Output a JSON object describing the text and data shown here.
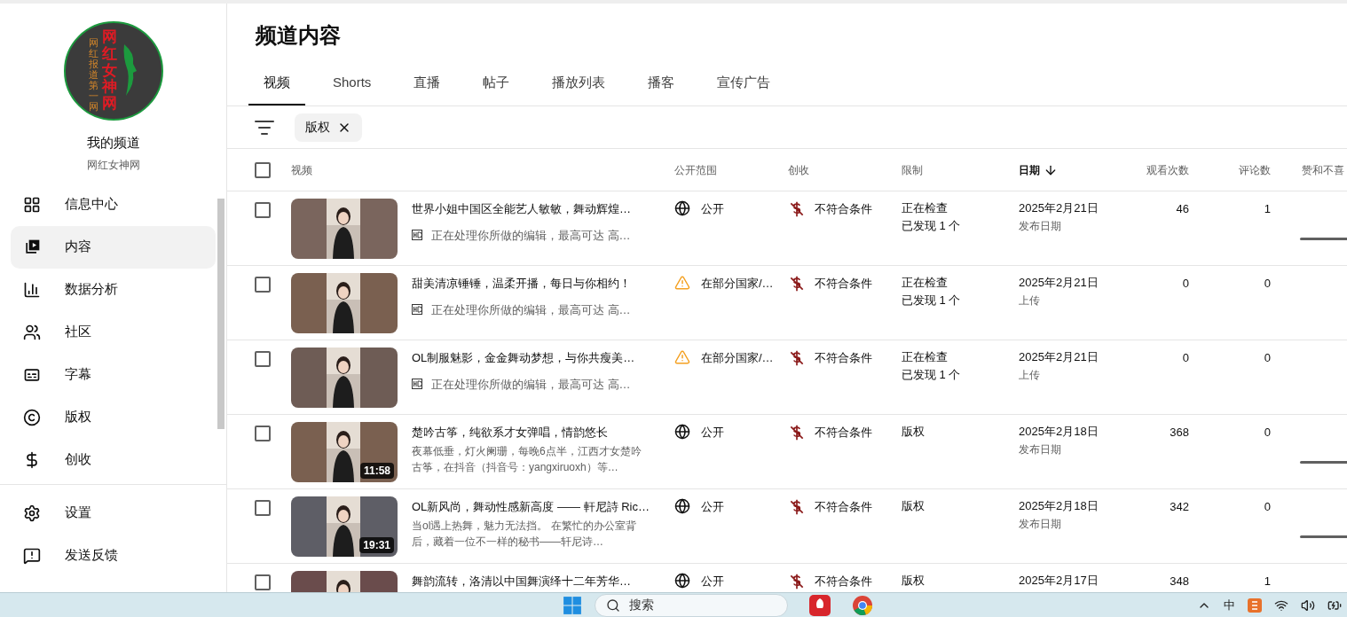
{
  "channel": {
    "logo_title": "网红女神网",
    "logo_slogan": "网红报道第一网",
    "name": "我的频道",
    "handle": "网红女神网"
  },
  "sidebar": {
    "items": [
      {
        "kind": "dashboard",
        "label": "信息中心",
        "selected": false
      },
      {
        "kind": "content",
        "label": "内容",
        "selected": true
      },
      {
        "kind": "analytics",
        "label": "数据分析",
        "selected": false
      },
      {
        "kind": "community",
        "label": "社区",
        "selected": false
      },
      {
        "kind": "subtitles",
        "label": "字幕",
        "selected": false
      },
      {
        "kind": "copyright",
        "label": "版权",
        "selected": false
      },
      {
        "kind": "earn",
        "label": "创收",
        "selected": false
      }
    ],
    "footer_items": [
      {
        "kind": "settings",
        "label": "设置"
      },
      {
        "kind": "feedback",
        "label": "发送反馈"
      }
    ]
  },
  "page": {
    "title": "频道内容"
  },
  "tabs": [
    {
      "label": "视频",
      "selected": true
    },
    {
      "label": "Shorts",
      "selected": false
    },
    {
      "label": "直播",
      "selected": false
    },
    {
      "label": "帖子",
      "selected": false
    },
    {
      "label": "播放列表",
      "selected": false
    },
    {
      "label": "播客",
      "selected": false
    },
    {
      "label": "宣传广告",
      "selected": false
    }
  ],
  "filter_chips": [
    {
      "label": "版权"
    }
  ],
  "table": {
    "select_all_checked": false,
    "columns": [
      {
        "label": "视频",
        "sorted": false
      },
      {
        "label": "公开范围",
        "sorted": false
      },
      {
        "label": "创收",
        "sorted": false
      },
      {
        "label": "限制",
        "sorted": false
      },
      {
        "label": "日期",
        "sorted": true
      },
      {
        "label": "观看次数",
        "sorted": false
      },
      {
        "label": "评论数",
        "sorted": false
      },
      {
        "label": "赞和不喜",
        "sorted": false
      }
    ],
    "rows": [
      {
        "checked": false,
        "title": "世界小姐中国区全能艺人敏敏，舞动辉煌…",
        "kind": "processing",
        "note": "正在处理你所做的编辑，最高可达 高…",
        "visibility": {
          "kind": "public",
          "label": "公开"
        },
        "monetization": "不符合条件",
        "restriction": [
          "正在检查",
          "已发现 1 个"
        ],
        "date": "2025年2月21日",
        "date_kind": "发布日期",
        "views": "46",
        "comments": "1",
        "like_bar": true
      },
      {
        "checked": false,
        "title": "甜美清凉锤锤，温柔开播，每日与你相约！",
        "kind": "processing",
        "note": "正在处理你所做的编辑，最高可达 高…",
        "visibility": {
          "kind": "restricted",
          "label": "在部分国家/…"
        },
        "monetization": "不符合条件",
        "restriction": [
          "正在检查",
          "已发现 1 个"
        ],
        "date": "2025年2月21日",
        "date_kind": "上传",
        "views": "0",
        "comments": "0",
        "like_bar": false
      },
      {
        "checked": false,
        "title": "OL制服魅影，金金舞动梦想，与你共瘦美…",
        "kind": "processing",
        "note": "正在处理你所做的编辑，最高可达 高…",
        "visibility": {
          "kind": "restricted",
          "label": "在部分国家/…"
        },
        "monetization": "不符合条件",
        "restriction": [
          "正在检查",
          "已发现 1 个"
        ],
        "date": "2025年2月21日",
        "date_kind": "上传",
        "views": "0",
        "comments": "0",
        "like_bar": false
      },
      {
        "checked": false,
        "title": "楚吟古筝，纯欲系才女弹唱，情韵悠长",
        "kind": "description",
        "note": "夜幕低垂，灯火阑珊，每晚6点半，江西才女楚吟古筝，在抖音（抖音号：yangxiruoxh）等…",
        "duration": "11:58",
        "visibility": {
          "kind": "public",
          "label": "公开"
        },
        "monetization": "不符合条件",
        "restriction": [
          "版权"
        ],
        "date": "2025年2月18日",
        "date_kind": "发布日期",
        "views": "368",
        "comments": "0",
        "like_bar": true
      },
      {
        "checked": false,
        "title": "OL新风尚，舞动性感新高度 —— 軒尼詩 Ric…",
        "kind": "description",
        "note": "当ol遇上热舞，魅力无法挡。 在繁忙的办公室背后，藏着一位不一样的秘书——轩尼诗…",
        "duration": "19:31",
        "visibility": {
          "kind": "public",
          "label": "公开"
        },
        "monetization": "不符合条件",
        "restriction": [
          "版权"
        ],
        "date": "2025年2月18日",
        "date_kind": "发布日期",
        "views": "342",
        "comments": "0",
        "like_bar": true
      },
      {
        "checked": false,
        "title": "舞韵流转，洛清以中国舞演绎十二年芳华…",
        "kind": "partial",
        "visibility": {
          "kind": "public",
          "label": "公开"
        },
        "monetization": "不符合条件",
        "restriction": [
          "版权"
        ],
        "date": "2025年2月17日",
        "views": "348",
        "comments": "1",
        "like_bar": false
      }
    ]
  },
  "taskbar": {
    "search_placeholder": "搜索",
    "input_method": "中"
  }
}
